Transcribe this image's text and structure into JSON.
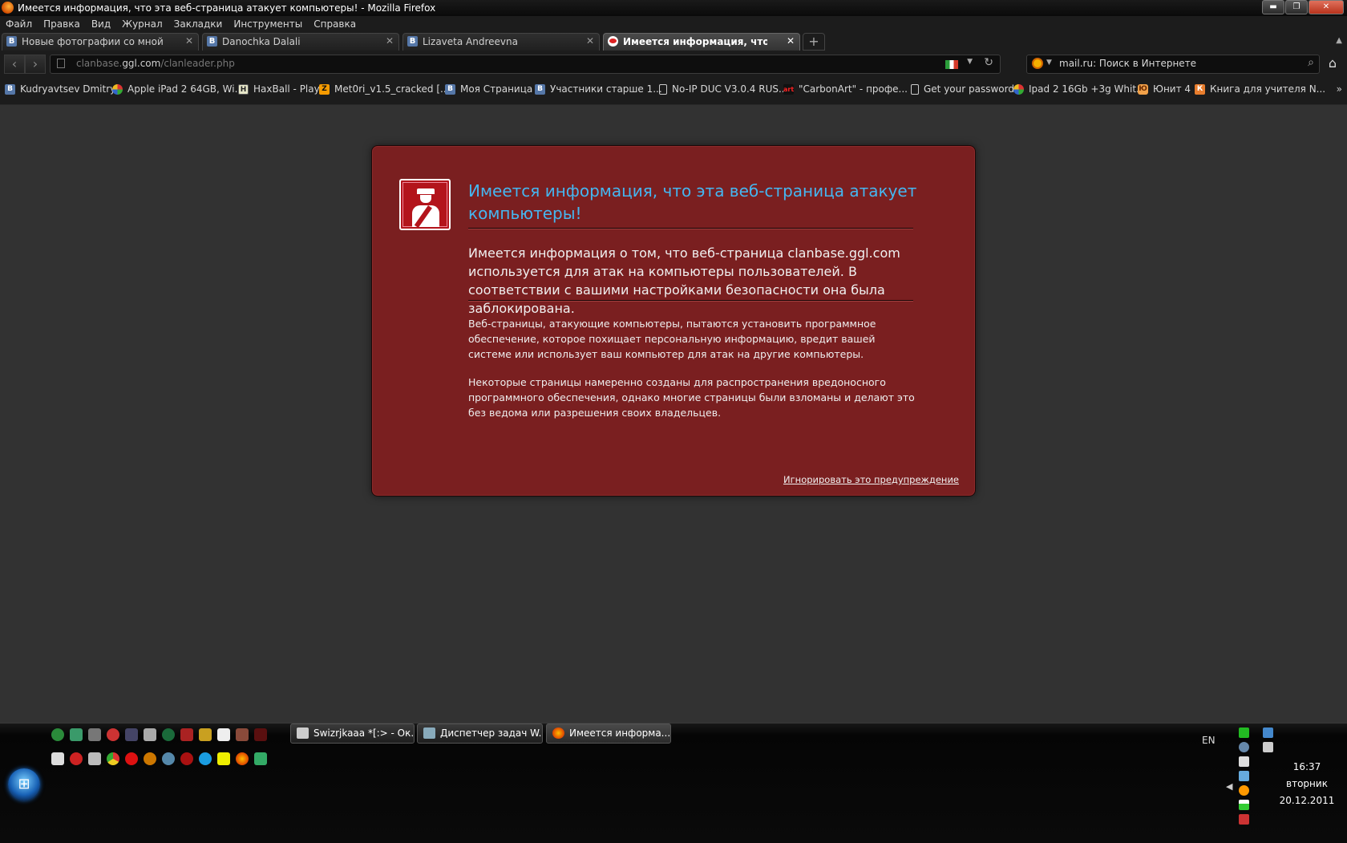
{
  "window": {
    "title": "Имеется информация, что эта веб-страница атакует компьютеры! - Mozilla Firefox",
    "minimize": "▬",
    "maximize": "❐",
    "close": "✕"
  },
  "menu": [
    "Файл",
    "Правка",
    "Вид",
    "Журнал",
    "Закладки",
    "Инструменты",
    "Справка"
  ],
  "tabs": [
    {
      "label": "Новые фотографии со мной",
      "icon": "B",
      "active": false
    },
    {
      "label": "Danochka Dalali",
      "icon": "B",
      "active": false
    },
    {
      "label": "Lizaveta Andreevna",
      "icon": "B",
      "active": false
    },
    {
      "label": "Имеется информация, что эта ве...",
      "icon": "",
      "active": true
    }
  ],
  "tab_close": "✕",
  "new_tab": "+",
  "tab_list": "▲",
  "nav": {
    "back": "‹",
    "forward": "›",
    "url_prefix": "clanbase.",
    "url_domain": "ggl.com",
    "url_path": "/clanleader.php",
    "url_drop": "▼",
    "reload": "↻",
    "search_placeholder": "mail.ru: Поиск в Интернете",
    "search_drop": "▼",
    "search_go": "⌕",
    "home": "⌂"
  },
  "bookmarks": [
    {
      "label": "Kudryavtsev Dmitry",
      "icon": "vk",
      "glyph": "B"
    },
    {
      "label": "Apple iPad 2 64GB, Wi...",
      "icon": "multi",
      "glyph": ""
    },
    {
      "label": "HaxBall - Play",
      "icon": "hax",
      "glyph": "H"
    },
    {
      "label": "Met0ri_v1.5_cracked [...",
      "icon": "z",
      "glyph": "Z"
    },
    {
      "label": "Моя Страница",
      "icon": "vk",
      "glyph": "B"
    },
    {
      "label": "Участники старше 1...",
      "icon": "vk",
      "glyph": "B"
    },
    {
      "label": "No-IP DUC V3.0.4 RUS...",
      "icon": "page",
      "glyph": ""
    },
    {
      "label": "\"CarbonArt\" - профе...",
      "icon": "art",
      "glyph": "art"
    },
    {
      "label": "Get your password",
      "icon": "page",
      "glyph": ""
    },
    {
      "label": "Ipad 2 16Gb +3g Whit...",
      "icon": "multi",
      "glyph": ""
    },
    {
      "label": "Юнит 4",
      "icon": "unit",
      "glyph": "Ю"
    },
    {
      "label": "Книга для учителя N...",
      "icon": "book",
      "glyph": "К"
    }
  ],
  "bookmarks_more": "»",
  "warning": {
    "title": "Имеется информация, что эта веб-страница атакует компьютеры!",
    "short_desc": "Имеется информация о том, что веб-страница clanbase.ggl.com используется для атак на компьютеры пользователей. В соответствии с вашими настройками безопасности она была заблокирована.",
    "long_desc_1": "Веб-страницы, атакующие компьютеры, пытаются установить программное обеспечение, которое похищает персональную информацию, вредит вашей системе или использует ваш компьютер для атак на другие компьютеры.",
    "long_desc_2": "Некоторые страницы намеренно созданы для распространения вредоносного программного обеспечения, однако многие страницы были взломаны и делают это без ведома или разрешения своих владельцев.",
    "ignore_link": "Игнорировать это предупреждение"
  },
  "taskbar": {
    "start_glyph": "⊞",
    "buttons": [
      {
        "label": "Swizrjkaaa *[:> - Ок..."
      },
      {
        "label": "Диспетчер задач W..."
      },
      {
        "label": "Имеется информа..."
      }
    ],
    "lang": "EN",
    "tray_arrow": "◀",
    "time": "16:37",
    "weekday": "вторник",
    "date": "20.12.2011"
  },
  "colors": {
    "warning_bg": "#7a1f20",
    "warning_title": "#45b6f0",
    "chrome_bg": "#1c1c1c",
    "page_bg": "#323232"
  }
}
